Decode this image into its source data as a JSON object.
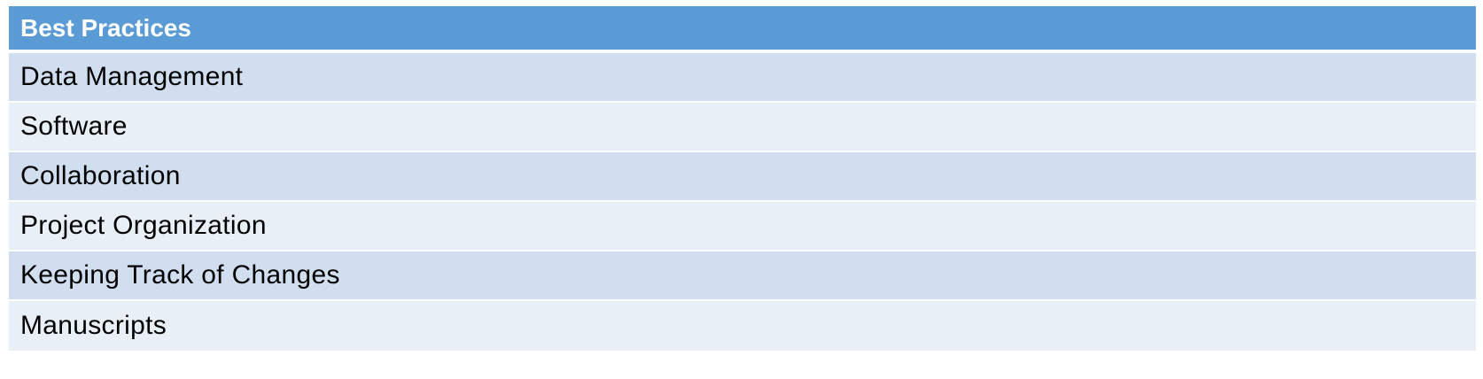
{
  "table": {
    "header": "Best Practices",
    "rows": [
      "Data Management",
      "Software",
      "Collaboration",
      "Project Organization",
      "Keeping Track of Changes",
      "Manuscripts"
    ]
  },
  "colors": {
    "header_bg": "#5b9bd5",
    "row_band_dark": "#d0deef",
    "row_band_light": "#e9eff7"
  }
}
